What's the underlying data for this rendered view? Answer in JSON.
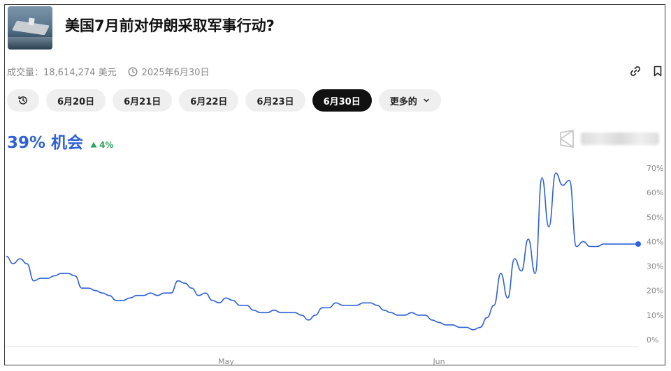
{
  "market": {
    "title": "美国7月前对伊朗采取军事行动?",
    "volume": "成交量：18,614,274 美元",
    "end_date": "2025年6月30日"
  },
  "tabs": [
    {
      "label": "6月20日",
      "active": false
    },
    {
      "label": "6月21日",
      "active": false
    },
    {
      "label": "6月22日",
      "active": false
    },
    {
      "label": "6月23日",
      "active": false
    },
    {
      "label": "6月30日",
      "active": true
    }
  ],
  "more_label": "更多的",
  "headline": {
    "value": "39% 机会",
    "change": "4%"
  },
  "icons": [
    "history-icon",
    "clock-icon",
    "link-icon",
    "bookmark-icon",
    "chevron-down-icon",
    "triangle-up-icon",
    "brand-logo-icon"
  ],
  "colors": {
    "line": "#2f62d6",
    "positive": "#2aa55a",
    "active_tab": "#111111"
  },
  "chart_data": {
    "type": "line",
    "x_start": "2025-03-30",
    "x_end": "2025-06-30",
    "xticks": [
      {
        "value": "2025-05-01",
        "label": "May"
      },
      {
        "value": "2025-06-01",
        "label": "Jun"
      }
    ],
    "ylim": [
      0,
      70
    ],
    "yticks": [
      0,
      10,
      20,
      30,
      40,
      50,
      60,
      70
    ],
    "ytick_suffix": "%",
    "grid": false,
    "series": [
      {
        "x": [
          "2025-03-30",
          "2025-03-31",
          "2025-04-01",
          "2025-04-02",
          "2025-04-03",
          "2025-04-04",
          "2025-04-05",
          "2025-04-06",
          "2025-04-07",
          "2025-04-08",
          "2025-04-09",
          "2025-04-10",
          "2025-04-11",
          "2025-04-12",
          "2025-04-13",
          "2025-04-14",
          "2025-04-15",
          "2025-04-16",
          "2025-04-17",
          "2025-04-18",
          "2025-04-19",
          "2025-04-20",
          "2025-04-21",
          "2025-04-22",
          "2025-04-23",
          "2025-04-24",
          "2025-04-25",
          "2025-04-26",
          "2025-04-27",
          "2025-04-28",
          "2025-04-29",
          "2025-04-30",
          "2025-05-01",
          "2025-05-02",
          "2025-05-03",
          "2025-05-04",
          "2025-05-05",
          "2025-05-06",
          "2025-05-07",
          "2025-05-08",
          "2025-05-09",
          "2025-05-10",
          "2025-05-11",
          "2025-05-12",
          "2025-05-13",
          "2025-05-14",
          "2025-05-15",
          "2025-05-16",
          "2025-05-17",
          "2025-05-18",
          "2025-05-19",
          "2025-05-20",
          "2025-05-21",
          "2025-05-22",
          "2025-05-23",
          "2025-05-24",
          "2025-05-25",
          "2025-05-26",
          "2025-05-27",
          "2025-05-28",
          "2025-05-29",
          "2025-05-30",
          "2025-05-31",
          "2025-06-01",
          "2025-06-02",
          "2025-06-03",
          "2025-06-04",
          "2025-06-05",
          "2025-06-06",
          "2025-06-07",
          "2025-06-08",
          "2025-06-09",
          "2025-06-10",
          "2025-06-11",
          "2025-06-12",
          "2025-06-13",
          "2025-06-14",
          "2025-06-15",
          "2025-06-16",
          "2025-06-17",
          "2025-06-18",
          "2025-06-19",
          "2025-06-20",
          "2025-06-21",
          "2025-06-22",
          "2025-06-23",
          "2025-06-24",
          "2025-06-25",
          "2025-06-26",
          "2025-06-27",
          "2025-06-28",
          "2025-06-29",
          "2025-06-30"
        ],
        "values": [
          34,
          31,
          33,
          31,
          24,
          25,
          25,
          26,
          27,
          27,
          26,
          21,
          21,
          20,
          19,
          18,
          16,
          16,
          17,
          18,
          18,
          19,
          18,
          19,
          19,
          24,
          23,
          21,
          18,
          19,
          16,
          15,
          17,
          16,
          14,
          14,
          12,
          11,
          11,
          12,
          11,
          11,
          11,
          10,
          8,
          10,
          13,
          13,
          15,
          14,
          14,
          14,
          15,
          15,
          14,
          12,
          11,
          10,
          10,
          11,
          10,
          10,
          8,
          7,
          6,
          6,
          5,
          5,
          4,
          5,
          9,
          14,
          27,
          17,
          33,
          28,
          41,
          27,
          66,
          46,
          68,
          63,
          65,
          38,
          40,
          38,
          38,
          39,
          39,
          39,
          39,
          39,
          39
        ]
      }
    ]
  }
}
